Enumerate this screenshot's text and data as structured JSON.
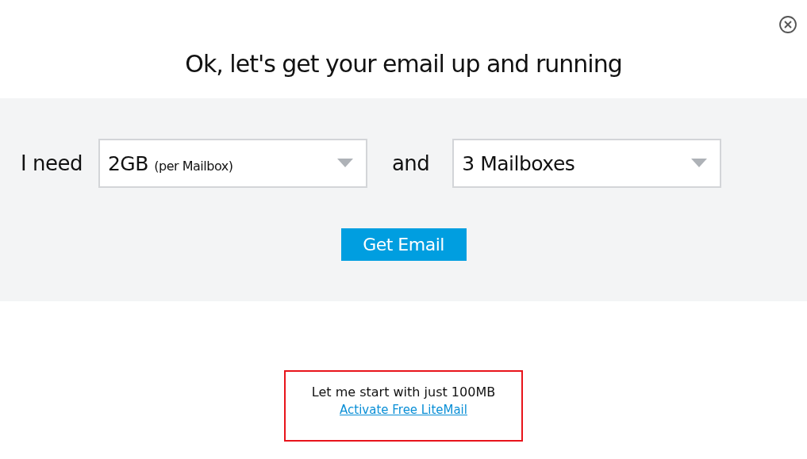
{
  "title": "Ok, let's get your email up and running",
  "form": {
    "label_before": "I need",
    "storage": {
      "value": "2GB",
      "note": "(per Mailbox)"
    },
    "label_between": "and",
    "mailboxes": {
      "value": "3 Mailboxes"
    },
    "button": "Get Email"
  },
  "free_offer": {
    "text": "Let me start with just 100MB",
    "link": "Activate Free LiteMail"
  }
}
